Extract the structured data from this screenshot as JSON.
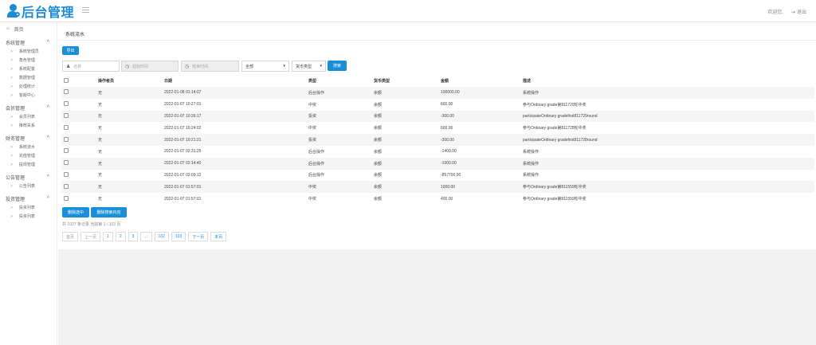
{
  "header": {
    "logo_text": "后台管理",
    "welcome": "欢迎您,",
    "logout": "退出"
  },
  "sidebar": {
    "home": "首页",
    "groups": [
      {
        "label": "系统管理",
        "items": [
          "系统管理员",
          "角色管理",
          "系统配置",
          "数据管理",
          "处理统计",
          "客服中心"
        ]
      },
      {
        "label": "会员管理",
        "items": [
          "会员列表",
          "推荐关系"
        ]
      },
      {
        "label": "财务管理",
        "items": [
          "系统流水",
          "充值管理",
          "提现管理"
        ]
      },
      {
        "label": "公告管理",
        "items": [
          "公告列表"
        ]
      },
      {
        "label": "投资管理",
        "items": [
          "投资列表",
          "投资列表"
        ]
      }
    ]
  },
  "page": {
    "tab_title": "系统流水",
    "export_label": "导出",
    "filters": {
      "name_placeholder": "名称",
      "start_placeholder": "起始时间",
      "end_placeholder": "结束时间",
      "type_value": "全部",
      "currency_value": "货币类型",
      "search_label": "搜索"
    },
    "columns": [
      "操作者员",
      "日期",
      "类型",
      "货币类型",
      "金额",
      "描述"
    ],
    "rows": [
      {
        "operator": "无",
        "date": "2022-01-08 01:14:07",
        "type": "后台操作",
        "currency": "余额",
        "amount": "100000.00",
        "desc": "系统操作"
      },
      {
        "operator": "无",
        "date": "2022-01-07 10:27:01",
        "type": "中奖",
        "currency": "余额",
        "amount": "600.00",
        "desc": "参与Ordinary grade第811729轮中奖"
      },
      {
        "operator": "无",
        "date": "2022-01-07 10:26:17",
        "type": "投资",
        "currency": "余额",
        "amount": "-300.00",
        "desc": "participateOrdinary gradefirst811729round"
      },
      {
        "operator": "无",
        "date": "2022-01-07 10:24:02",
        "type": "中奖",
        "currency": "余额",
        "amount": "600.00",
        "desc": "参与Ordinary grade第811728轮中奖"
      },
      {
        "operator": "无",
        "date": "2022-01-07 10:21:21",
        "type": "投资",
        "currency": "余额",
        "amount": "-300.00",
        "desc": "participateOrdinary gradefirst811728round"
      },
      {
        "operator": "无",
        "date": "2022-01-07 02:31:25",
        "type": "后台操作",
        "currency": "余额",
        "amount": "-1400.00",
        "desc": "系统操作"
      },
      {
        "operator": "无",
        "date": "2022-01-07 02:14:40",
        "type": "后台操作",
        "currency": "余额",
        "amount": "-1000.00",
        "desc": "系统操作"
      },
      {
        "operator": "无",
        "date": "2022-01-07 02:09:12",
        "type": "后台操作",
        "currency": "余额",
        "amount": "-857700.00",
        "desc": "系统操作"
      },
      {
        "operator": "无",
        "date": "2022-01-07 01:57:01",
        "type": "中奖",
        "currency": "余额",
        "amount": "1000.00",
        "desc": "参与Ordinary grade第811559轮中奖"
      },
      {
        "operator": "无",
        "date": "2022-01-07 01:57:01",
        "type": "中奖",
        "currency": "余额",
        "amount": "400.00",
        "desc": "参与Ordinary grade第811559轮中奖"
      }
    ],
    "bulk_delete_selected": "删除选中",
    "bulk_delete_search": "删除搜索内容",
    "summary": "共 1027 条记录   当前第 1 / 103 页",
    "pager": [
      "首页",
      "上一页",
      "1",
      "2",
      "3",
      "...",
      "102",
      "103",
      "下一页",
      "末页"
    ]
  }
}
